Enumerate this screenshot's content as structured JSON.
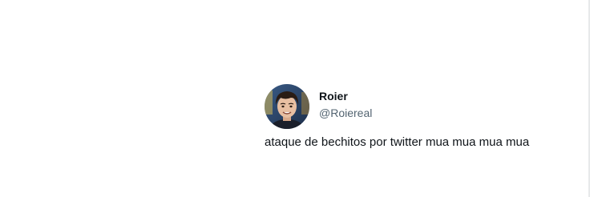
{
  "tweet": {
    "author": {
      "display_name": "Roier",
      "handle": "@Roiereal",
      "avatar_icon": "profile-photo"
    },
    "text": "ataque de bechitos por twitter mua mua mua mua"
  },
  "colors": {
    "background": "#ffffff",
    "text_primary": "#0f1419",
    "text_secondary": "#536471"
  }
}
